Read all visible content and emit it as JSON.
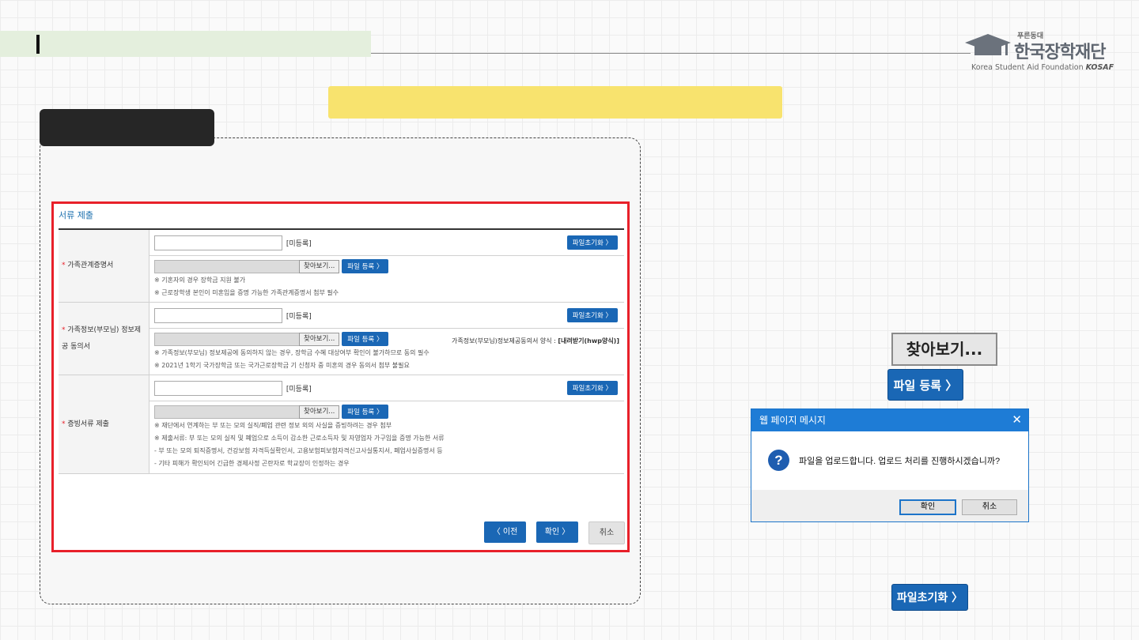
{
  "logo": {
    "slogan": "푸른동대",
    "name": "한국장학재단",
    "english": "Korea Student Aid Foundation",
    "abbr": "KOSAF"
  },
  "form": {
    "section_title": "서류 제출",
    "unregistered": "[미등록]",
    "reset_label": "파일초기화 〉",
    "find_label": "찾아보기...",
    "upload_label": "파일 등록 〉",
    "rows": [
      {
        "required_mark": "*",
        "label": "가족관계증명서",
        "notes": [
          "※ 기혼자의 경우 장학금 지원 불가",
          "※ 근로장학생 본인이 미혼임을 증명 가능한 가족관계증명서 첨부 필수"
        ]
      },
      {
        "required_mark": "*",
        "label": "가족정보(부모님) 정보제공 동의서",
        "hwp_prefix": "가족정보(부모님)정보제공동의서 양식 :",
        "hwp_link": "[내려받기(hwp양식)]",
        "notes": [
          "※ 가족정보(부모님) 정보제공에 동의하지 않는 경우, 장학금 수혜 대상여부 확인이 불가하므로 동의 필수",
          "※ 2021년 1학기 국가장학금 또는 국가근로장학금 기 신청자 중 미혼의 경우 동의서 첨부 불필요"
        ]
      },
      {
        "required_mark": "*",
        "label": "증빙서류 제출",
        "notes": [
          "※ 재단에서 연계하는 부 또는 모의 실직/폐업 관련 정보 외의 사실을 증빙하려는 경우 첨부",
          "※ 제출서류: 부 또는 모의 실직 및 폐업으로 소득이 감소한 근로소득자 및 자영업자 가구임을 증명 가능한 서류",
          "- 부 또는 모의 퇴직증명서, 건강보험 자격득실확인서, 고용보험피보험자격신고사실통지서, 폐업사실증명서 등",
          "- 기타 피해가 확인되어 긴급한 경제사정 곤란자로 학교장이 인정하는 경우"
        ]
      }
    ],
    "nav": {
      "prev": "〈  이전",
      "ok": "확인  〉",
      "cancel": "취소"
    }
  },
  "zoom_buttons": {
    "find": "찾아보기...",
    "upload": "파일 등록 〉",
    "reset": "파일초기화 〉"
  },
  "dialog": {
    "title": "웹 페이지 메시지",
    "close": "✕",
    "icon": "?",
    "message": "파일을 업로드합니다. 업로드 처리를 진행하시겠습니까?",
    "ok": "확인",
    "cancel": "취소"
  },
  "colors": {
    "accent_blue": "#1a67b5",
    "highlight_red": "#e8202a",
    "yellow": "#f8e36e",
    "title_green": "#e4efdd"
  }
}
